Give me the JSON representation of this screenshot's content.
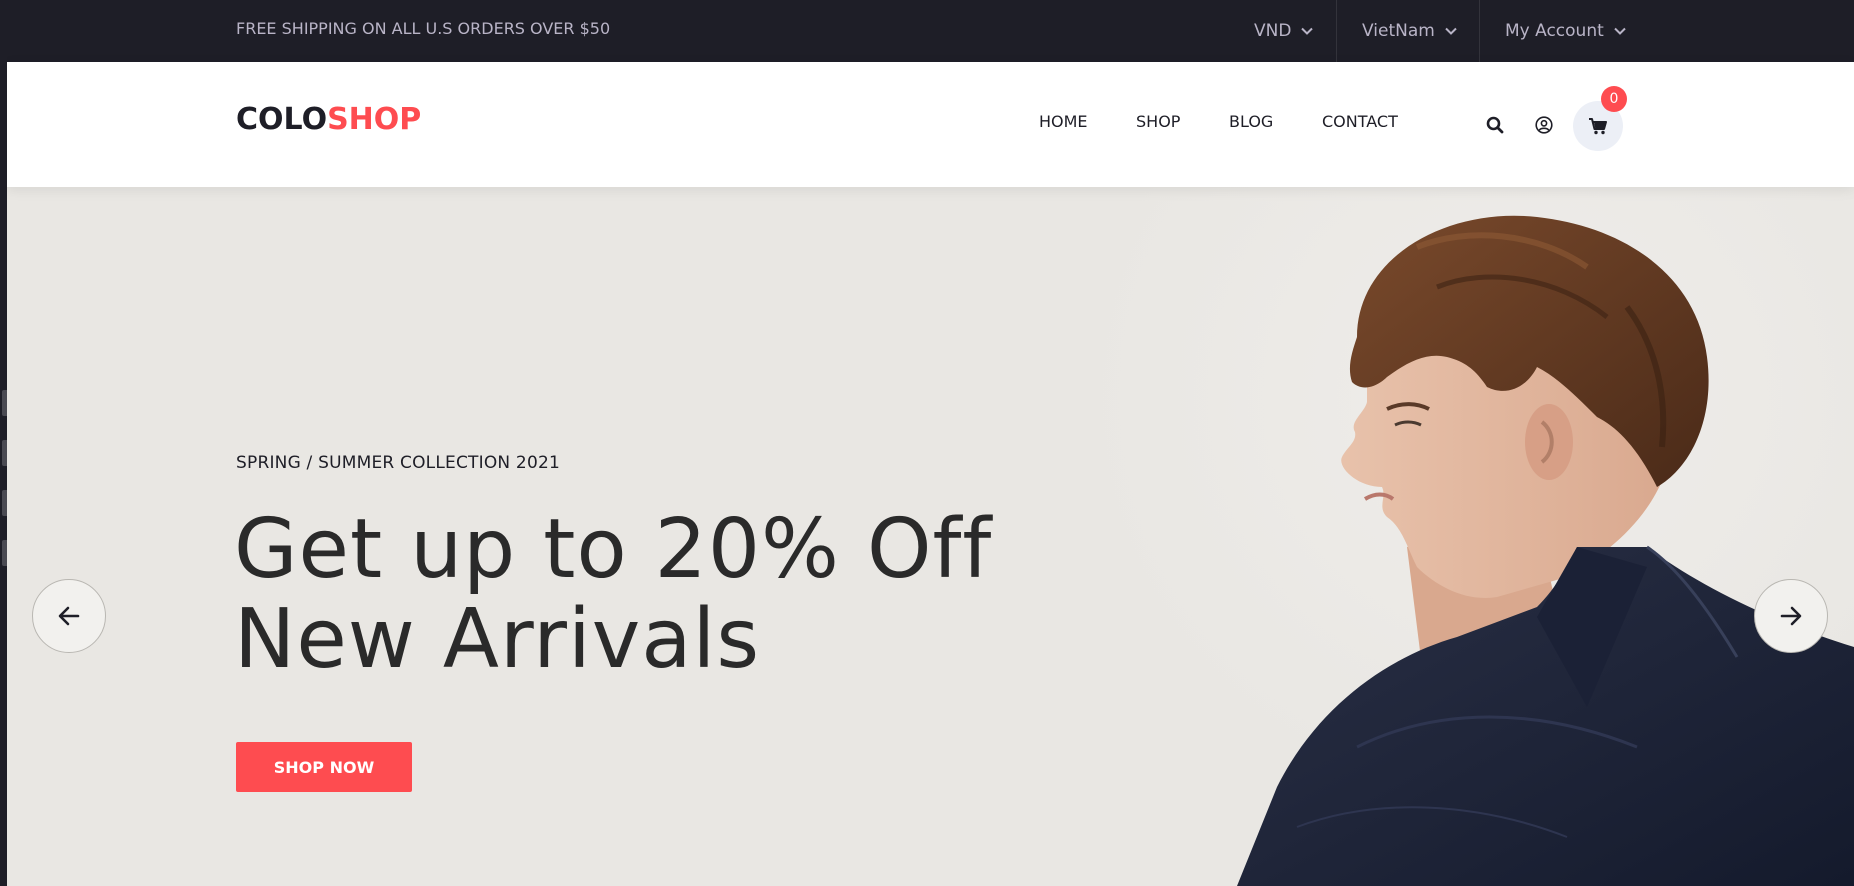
{
  "topbar": {
    "promo": "FREE SHIPPING ON ALL U.S ORDERS OVER $50",
    "currency": "VND",
    "country": "VietNam",
    "account": "My Account"
  },
  "header": {
    "logo_part1": "COLO",
    "logo_part2": "SHOP",
    "nav": [
      "HOME",
      "SHOP",
      "BLOG",
      "CONTACT"
    ],
    "cart_count": "0"
  },
  "hero": {
    "subtitle": "SPRING / SUMMER COLLECTION 2021",
    "headline_line1": "Get up to 20% Off",
    "headline_line2": "New Arrivals",
    "cta": "SHOP NOW"
  },
  "icons": [
    "chevron-down-icon",
    "search-icon",
    "user-icon",
    "cart-icon",
    "arrow-left-icon",
    "arrow-right-icon"
  ],
  "colors": {
    "topbar_bg": "#1e1e27",
    "accent": "#fe4c50",
    "hero_bg": "#e9e7e3"
  }
}
